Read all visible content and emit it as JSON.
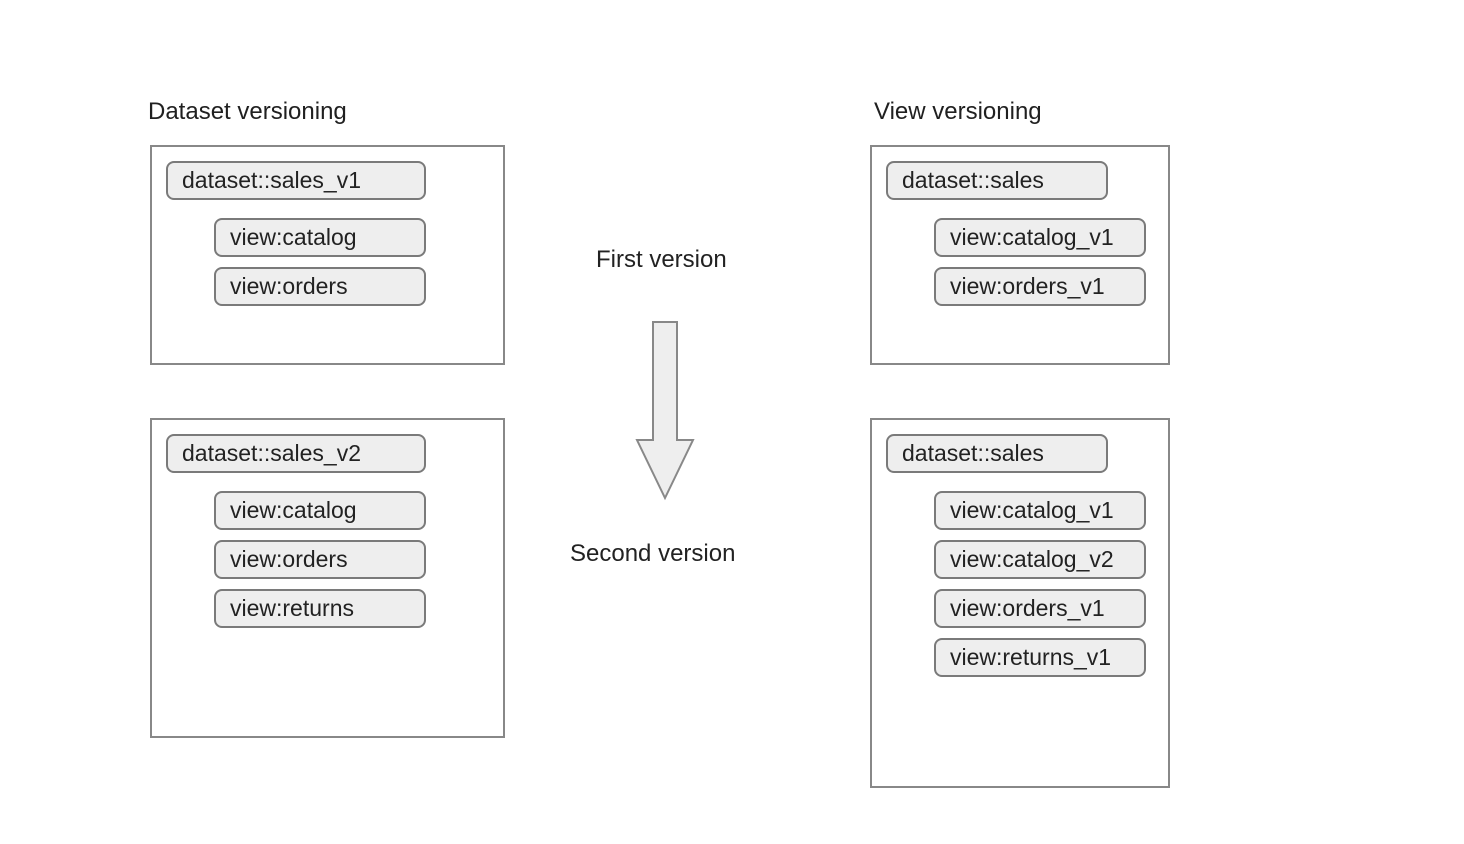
{
  "left": {
    "heading": "Dataset versioning",
    "v1": {
      "dataset": "dataset::sales_v1",
      "views": [
        "view:catalog",
        "view:orders"
      ]
    },
    "v2": {
      "dataset": "dataset::sales_v2",
      "views": [
        "view:catalog",
        "view:orders",
        "view:returns"
      ]
    }
  },
  "right": {
    "heading": "View versioning",
    "v1": {
      "dataset": "dataset::sales",
      "views": [
        "view:catalog_v1",
        "view:orders_v1"
      ]
    },
    "v2": {
      "dataset": "dataset::sales",
      "views": [
        "view:catalog_v1",
        "view:catalog_v2",
        "view:orders_v1",
        "view:returns_v1"
      ]
    }
  },
  "mid": {
    "first": "First version",
    "second": "Second version"
  }
}
